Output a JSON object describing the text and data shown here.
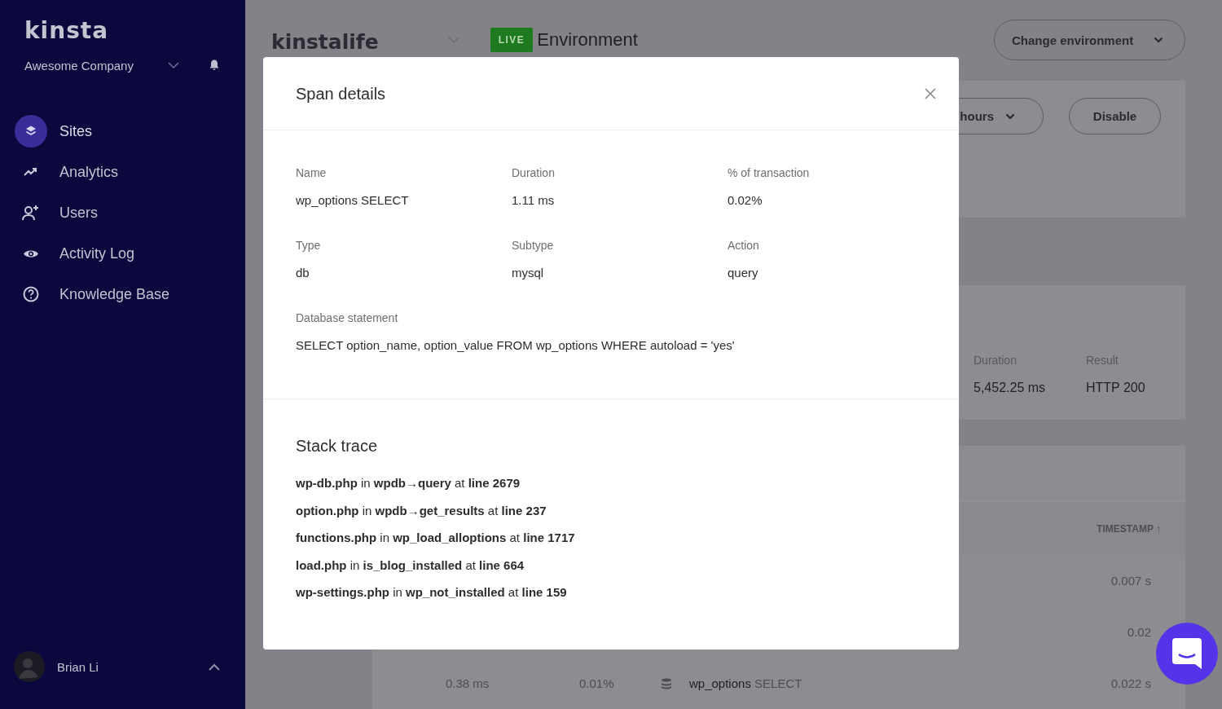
{
  "sidebar": {
    "logo": "kinsta",
    "company": "Awesome Company",
    "nav": [
      {
        "label": "Sites",
        "selected": true
      },
      {
        "label": "Analytics",
        "selected": false
      },
      {
        "label": "Users",
        "selected": false
      },
      {
        "label": "Activity Log",
        "selected": false
      },
      {
        "label": "Knowledge Base",
        "selected": false
      }
    ],
    "user": {
      "name": "Brian Li"
    }
  },
  "header": {
    "site": "kinstalife",
    "environment_badge": "LIVE",
    "environment_label": "Environment",
    "change_button": "Change environment"
  },
  "monitoring_card": {
    "range_button": "hours",
    "disable_button": "Disable"
  },
  "transaction_card": {
    "columns": [
      {
        "label": "Duration",
        "value": "5,452.25 ms"
      },
      {
        "label": "Result",
        "value": "HTTP 200"
      }
    ]
  },
  "spans_table": {
    "timestamp_header": "TIMESTAMP",
    "sort_arrow": "↑",
    "rows": [
      {
        "timestamp": "0.007 s"
      },
      {
        "timestamp": "0.02"
      },
      {
        "kind": "db",
        "duration": "0.38 ms",
        "percent": "0.01%",
        "name": "wp_options",
        "operation": "SELECT",
        "timestamp": "0.022 s"
      }
    ]
  },
  "modal": {
    "title": "Span details",
    "fields": [
      {
        "label": "Name",
        "value": "wp_options SELECT"
      },
      {
        "label": "Duration",
        "value": "1.11 ms"
      },
      {
        "label": "% of transaction",
        "value": "0.02%"
      },
      {
        "label": "Type",
        "value": "db"
      },
      {
        "label": "Subtype",
        "value": "mysql"
      },
      {
        "label": "Action",
        "value": "query"
      }
    ],
    "statement": {
      "label": "Database statement",
      "value": "SELECT option_name, option_value FROM wp_options WHERE autoload = 'yes'"
    },
    "stack_trace": {
      "title": "Stack trace",
      "frames": [
        "**wp-db.php** in **wpdb→query** at **line 2679**",
        "**option.php** in **wpdb→get_results** at **line 237**",
        "**functions.php** in **wp_load_alloptions** at **line 1717**",
        "**load.php** in **is_blog_installed** at **line 664**",
        "**wp-settings.php** in **wp_not_installed** at **line 159**"
      ]
    }
  }
}
